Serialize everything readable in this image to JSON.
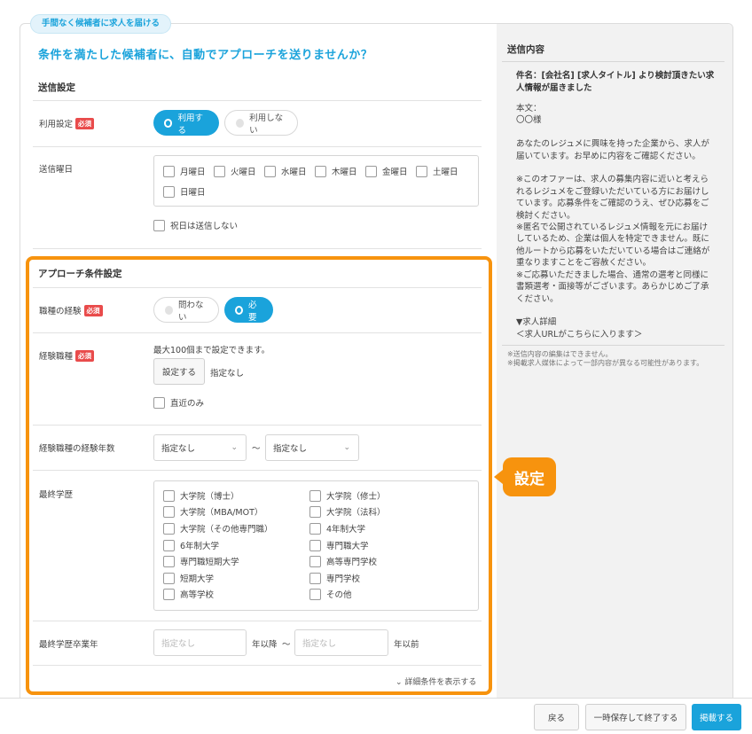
{
  "header": {
    "tag": "手間なく候補者に求人を届ける",
    "headline": "条件を満たした候補者に、自動でアプローチを送りませんか？"
  },
  "send_settings": {
    "title": "送信設定",
    "usage_label": "利用設定",
    "required": "必須",
    "use_on": "利用する",
    "use_off": "利用しない",
    "days_label": "送信曜日",
    "days": [
      "月曜日",
      "火曜日",
      "水曜日",
      "木曜日",
      "金曜日",
      "土曜日",
      "日曜日"
    ],
    "holiday": "祝日は送信しない"
  },
  "approach": {
    "title": "アプローチ条件設定",
    "exp_label": "職種の経験",
    "required": "必須",
    "exp_no": "問わない",
    "exp_yes": "必要",
    "jobs_label": "経験職種",
    "jobs_hint": "最大100個まで設定できます。",
    "jobs_button": "設定する",
    "jobs_value": "指定なし",
    "recent": "直近のみ",
    "years_label": "経験職種の経験年数",
    "years_from": "指定なし",
    "tilde": "〜",
    "years_to": "指定なし",
    "edu_label": "最終学歴",
    "edu_left": [
      "大学院（博士）",
      "大学院（MBA/MOT）",
      "大学院（その他専門職）",
      "6年制大学",
      "専門職短期大学",
      "短期大学",
      "高等学校"
    ],
    "edu_right": [
      "大学院（修士）",
      "大学院（法科）",
      "4年制大学",
      "専門職大学",
      "高等専門学校",
      "専門学校",
      "その他"
    ],
    "grad_label": "最終学歴卒業年",
    "grad_from_placeholder": "指定なし",
    "grad_after": "年以降",
    "grad_to_placeholder": "指定なし",
    "grad_before": "年以前",
    "more_link": "詳細条件を表示する"
  },
  "badge": "設定",
  "sidebar": {
    "title": "送信内容",
    "subject": "件名：[会社名] [求人タイトル] より検討頂きたい求人情報が届きました",
    "body": [
      "本文：",
      "〇〇様",
      "",
      "あなたのレジュメに興味を持った企業から、求人が届いています。お早めに内容をご確認ください。",
      "",
      "※このオファーは、求人の募集内容に近いと考えられるレジュメをご登録いただいている方にお届けしています。応募条件をご確認のうえ、ぜひ応募をご検討ください。",
      "※匿名で公開されているレジュメ情報を元にお届けしているため、企業は個人を特定できません。既に他ルートから応募をいただいている場合はご連絡が重なりますことをご容赦ください。",
      "※ご応募いただきました場合、通常の選考と同様に書類選考・面接等がございます。あらかじめご了承ください。",
      "",
      "▼求人詳細",
      "＜求人URLがこちらに入ります＞"
    ],
    "note1": "※送信内容の編集はできません。",
    "note2": "※掲載求人媒体によって一部内容が異なる可能性があります。"
  },
  "footer": {
    "back": "戻る",
    "save": "一時保存して終了する",
    "publish": "掲載する"
  }
}
